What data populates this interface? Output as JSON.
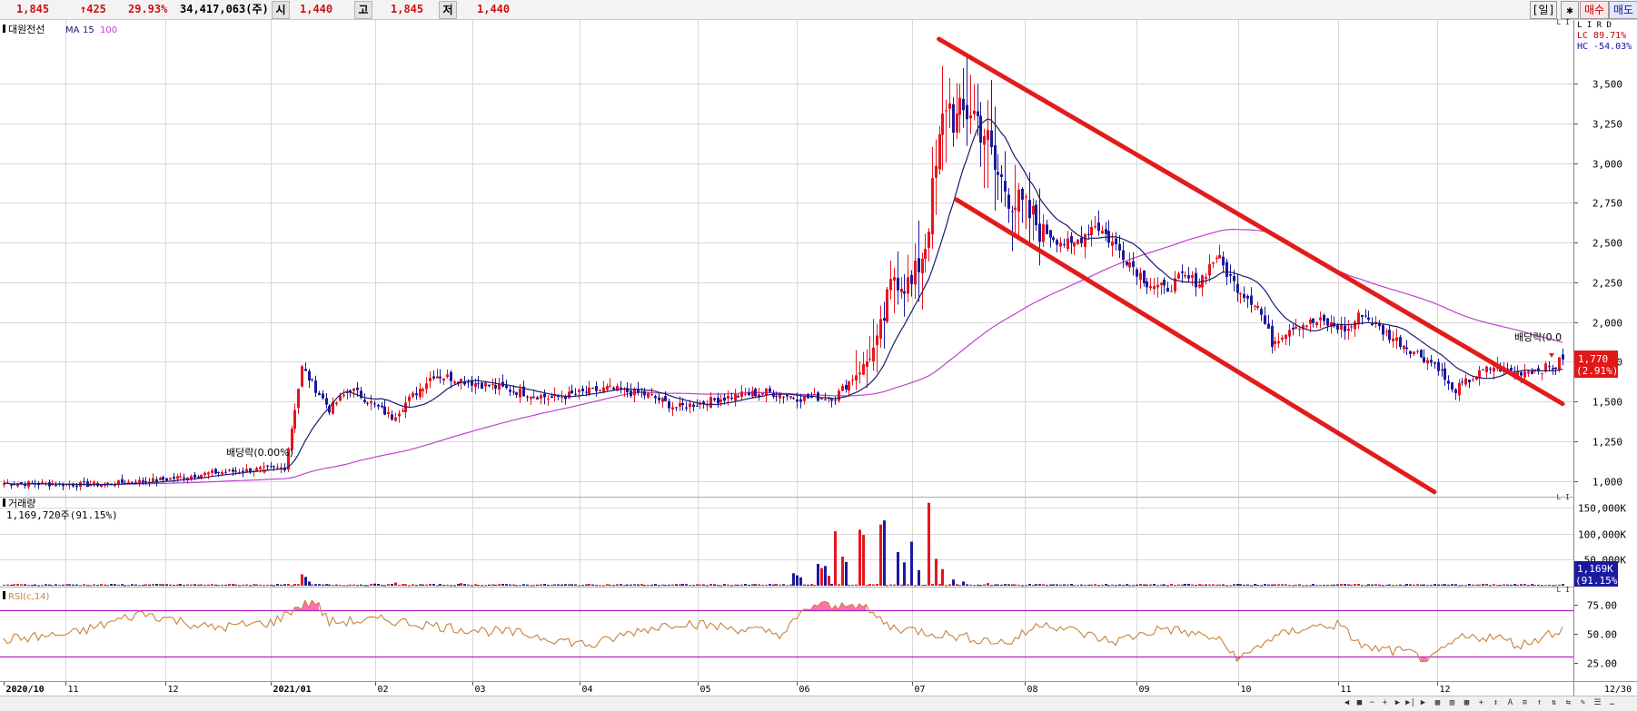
{
  "header": {
    "price": "1,845",
    "change": "↑425",
    "change_pct": "29.93%",
    "volume": "34,417,063(주)",
    "open_label": "시",
    "open": "1,440",
    "high_label": "고",
    "high": "1,845",
    "low_label": "저",
    "low": "1,440",
    "period_btn": "[일]",
    "settings_icon": "gear-icon",
    "buy_btn": "매수",
    "sell_btn": "매도"
  },
  "colors": {
    "up": "#e8141e",
    "down": "#1a1aa0",
    "ma15": "#1a1a70",
    "ma100": "#c040d0",
    "channel": "#e21b1b",
    "rsi": "#c8823c",
    "rsi_band": "#b020c0",
    "rsi_fill": "#ff70b0",
    "grid": "#d8d8d8"
  },
  "chart_data": [
    {
      "type": "candlestick",
      "title": "대원전선",
      "legend": [
        "MA",
        "15",
        "100"
      ],
      "scale_flags": "L I R D",
      "lc_text": "LC  89.71%",
      "hc_text": "HC -54.03%",
      "y_ticks": [
        "3,500",
        "3,250",
        "3,000",
        "2,750",
        "2,500",
        "2,250",
        "2,000",
        "1,750",
        "1,500",
        "1,250",
        "1,000"
      ],
      "y_tick_values": [
        3500,
        3250,
        3000,
        2750,
        2500,
        2250,
        2000,
        1750,
        1500,
        1250,
        1000
      ],
      "ylim": [
        900,
        3900
      ],
      "x_ticks": [
        "2020/10",
        "11",
        "12",
        "2021/01",
        "02",
        "03",
        "04",
        "05",
        "06",
        "07",
        "08",
        "09",
        "10",
        "11",
        "12"
      ],
      "bottom_right_label": "12/30",
      "price_box": [
        "1,770",
        "(2.91%)"
      ],
      "annotations": [
        "배당락(0.00%)",
        "배당락(0.0"
      ],
      "anchors": [
        [
          0,
          985
        ],
        [
          25,
          975
        ],
        [
          45,
          1005
        ],
        [
          60,
          1050
        ],
        [
          70,
          1065
        ],
        [
          81,
          1085
        ],
        [
          86,
          1710
        ],
        [
          94,
          1450
        ],
        [
          100,
          1580
        ],
        [
          112,
          1400
        ],
        [
          124,
          1670
        ],
        [
          142,
          1590
        ],
        [
          158,
          1520
        ],
        [
          174,
          1580
        ],
        [
          186,
          1540
        ],
        [
          194,
          1460
        ],
        [
          210,
          1530
        ],
        [
          220,
          1560
        ],
        [
          230,
          1520
        ],
        [
          240,
          1530
        ],
        [
          248,
          1720
        ],
        [
          252,
          1850
        ],
        [
          257,
          2300
        ],
        [
          262,
          2220
        ],
        [
          266,
          2500
        ],
        [
          268,
          2800
        ],
        [
          272,
          3400
        ],
        [
          275,
          3250
        ],
        [
          279,
          3350
        ],
        [
          283,
          3200
        ],
        [
          286,
          2950
        ],
        [
          292,
          2750
        ],
        [
          300,
          2580
        ],
        [
          308,
          2470
        ],
        [
          315,
          2620
        ],
        [
          322,
          2450
        ],
        [
          330,
          2250
        ],
        [
          335,
          2200
        ],
        [
          340,
          2280
        ],
        [
          345,
          2250
        ],
        [
          350,
          2420
        ],
        [
          355,
          2240
        ],
        [
          362,
          2100
        ],
        [
          366,
          1870
        ],
        [
          372,
          1980
        ],
        [
          380,
          2000
        ],
        [
          388,
          1950
        ],
        [
          392,
          2060
        ],
        [
          398,
          1940
        ],
        [
          406,
          1830
        ],
        [
          414,
          1720
        ],
        [
          418,
          1560
        ],
        [
          424,
          1650
        ],
        [
          430,
          1720
        ],
        [
          436,
          1680
        ],
        [
          442,
          1700
        ],
        [
          448,
          1720
        ],
        [
          450,
          1780
        ]
      ],
      "channel_lines": [
        {
          "from": {
            "bar": 270,
            "price": 3780
          },
          "to": {
            "bar": 450,
            "price": 1485
          }
        },
        {
          "from": {
            "bar": 275,
            "price": 2770
          },
          "to": {
            "bar": 413,
            "price": 930
          }
        }
      ]
    },
    {
      "type": "bar",
      "title": "거래량",
      "subtitle": "1,169,720주(91.15%)",
      "y_ticks": [
        "150,000K",
        "100,000K",
        "50,000K"
      ],
      "y_tick_values": [
        150000,
        100000,
        50000
      ],
      "ylim": [
        0,
        170000
      ],
      "current_box": [
        "1,169K",
        "(91.15%)"
      ],
      "spikes": [
        [
          86,
          22000
        ],
        [
          87,
          17000
        ],
        [
          88,
          8000
        ],
        [
          107,
          4000
        ],
        [
          113,
          6000
        ],
        [
          132,
          5000
        ],
        [
          228,
          24000
        ],
        [
          229,
          20000
        ],
        [
          230,
          16000
        ],
        [
          235,
          42000
        ],
        [
          236,
          34000
        ],
        [
          237,
          38000
        ],
        [
          238,
          19000
        ],
        [
          240,
          105000
        ],
        [
          242,
          56000
        ],
        [
          243,
          46000
        ],
        [
          247,
          108000
        ],
        [
          248,
          98000
        ],
        [
          253,
          118000
        ],
        [
          254,
          126000
        ],
        [
          258,
          65000
        ],
        [
          260,
          45000
        ],
        [
          262,
          85000
        ],
        [
          264,
          30000
        ],
        [
          267,
          160000
        ],
        [
          269,
          52000
        ],
        [
          271,
          32000
        ],
        [
          274,
          12000
        ],
        [
          277,
          8000
        ],
        [
          284,
          5000
        ]
      ],
      "baseline_range": [
        1000,
        3500
      ]
    },
    {
      "type": "line",
      "title": "RSI(c,14)",
      "y_ticks": [
        "75.00",
        "50.00",
        "25.00"
      ],
      "y_tick_values": [
        75,
        50,
        25
      ],
      "ylim": [
        10,
        90
      ],
      "upper_band": 70,
      "lower_band": 30,
      "anchors": [
        [
          0,
          45
        ],
        [
          20,
          50
        ],
        [
          40,
          68
        ],
        [
          60,
          55
        ],
        [
          78,
          60
        ],
        [
          84,
          72
        ],
        [
          90,
          78
        ],
        [
          94,
          60
        ],
        [
          110,
          62
        ],
        [
          130,
          55
        ],
        [
          150,
          50
        ],
        [
          170,
          40
        ],
        [
          182,
          52
        ],
        [
          195,
          60
        ],
        [
          210,
          55
        ],
        [
          225,
          50
        ],
        [
          232,
          72
        ],
        [
          236,
          76
        ],
        [
          240,
          71
        ],
        [
          244,
          78
        ],
        [
          248,
          73
        ],
        [
          256,
          56
        ],
        [
          270,
          50
        ],
        [
          290,
          42
        ],
        [
          300,
          60
        ],
        [
          320,
          43
        ],
        [
          335,
          55
        ],
        [
          350,
          46
        ],
        [
          357,
          28
        ],
        [
          365,
          45
        ],
        [
          375,
          55
        ],
        [
          385,
          58
        ],
        [
          393,
          38
        ],
        [
          405,
          34
        ],
        [
          412,
          27
        ],
        [
          420,
          46
        ],
        [
          430,
          48
        ],
        [
          438,
          40
        ],
        [
          446,
          50
        ],
        [
          450,
          54
        ]
      ]
    }
  ]
}
